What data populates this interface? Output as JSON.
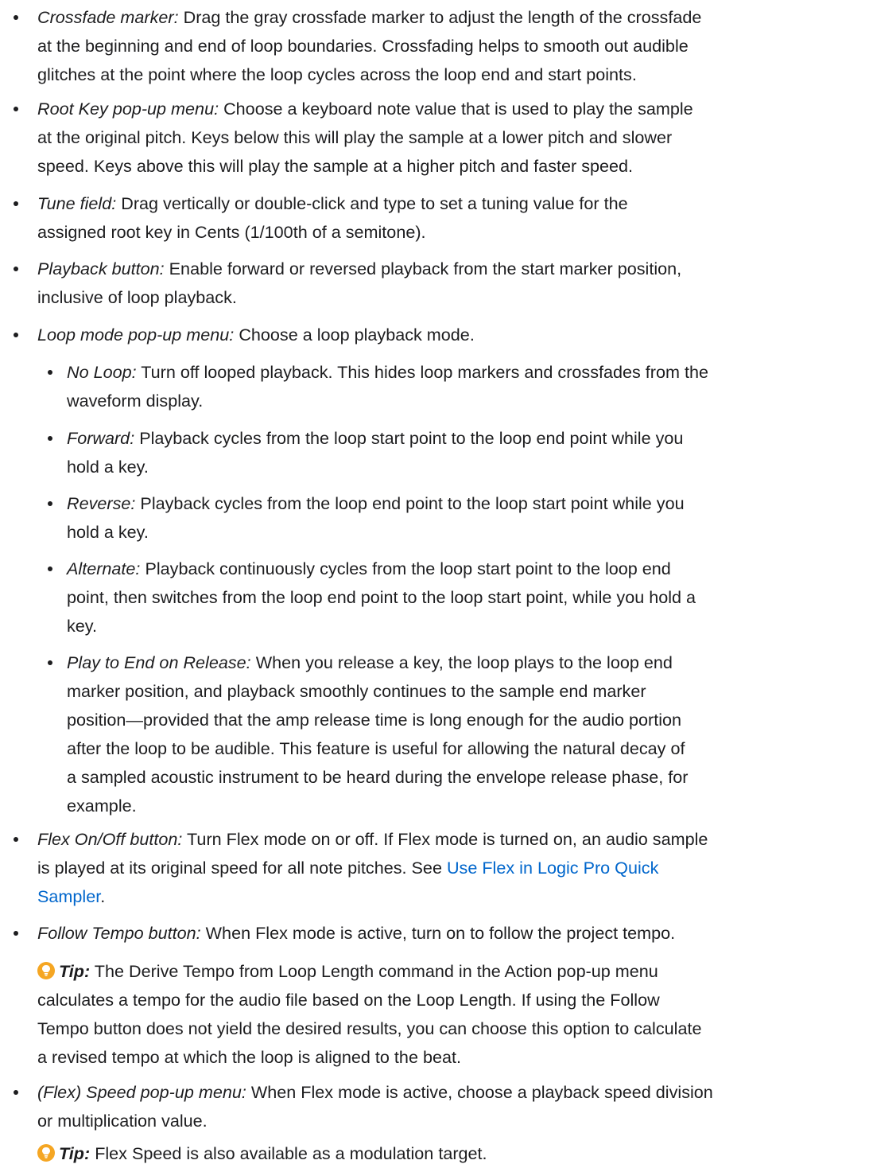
{
  "items": {
    "crossfade": {
      "term": "Crossfade marker:",
      "line1": "Drag the gray crossfade marker to adjust the length of the crossfade",
      "line2": "at the beginning and end of loop boundaries. Crossfading helps to smooth out audible",
      "line3": "glitches at the point where the loop cycles across the loop end and start points."
    },
    "root_key": {
      "term": "Root Key pop-up menu:",
      "line1": "Choose a keyboard note value that is used to play the sample",
      "line2": "at the original pitch. Keys below this will play the sample at a lower pitch and slower",
      "line3": "speed. Keys above this will play the sample at a higher pitch and faster speed."
    },
    "tune": {
      "term": "Tune field:",
      "line1": "Drag vertically or double-click and type to set a tuning value for the",
      "line2": "assigned root key in Cents (1/100th of a semitone)."
    },
    "playback": {
      "term": "Playback button:",
      "line1": "Enable forward or reversed playback from the start marker position,",
      "line2": "inclusive of loop playback."
    },
    "loop_mode": {
      "term": "Loop mode pop-up menu:",
      "line1": "Choose a loop playback mode.",
      "sub": {
        "no_loop": {
          "term": "No Loop:",
          "line1": "Turn off looped playback. This hides loop markers and crossfades from the",
          "line2": "waveform display."
        },
        "forward": {
          "term": "Forward:",
          "line1": "Playback cycles from the loop start point to the loop end point while you",
          "line2": "hold a key."
        },
        "reverse": {
          "term": "Reverse:",
          "line1": "Playback cycles from the loop end point to the loop start point while you",
          "line2": "hold a key."
        },
        "alternate": {
          "term": "Alternate:",
          "line1": "Playback continuously cycles from the loop start point to the loop end",
          "line2": "point, then switches from the loop end point to the loop start point, while you hold a",
          "line3": "key."
        },
        "play_to_end": {
          "term": "Play to End on Release:",
          "line1": "When you release a key, the loop plays to the loop end",
          "line2": "marker position, and playback smoothly continues to the sample end marker",
          "line3": "position—provided that the amp release time is long enough for the audio portion",
          "line4": "after the loop to be audible. This feature is useful for allowing the natural decay of",
          "line5": "a sampled acoustic instrument to be heard during the envelope release phase, for",
          "line6": "example."
        }
      }
    },
    "flex": {
      "term": "Flex On/Off button:",
      "line1": "Turn Flex mode on or off. If Flex mode is turned on, an audio sample",
      "line2": "is played at its original speed for all note pitches. See",
      "link_part1": "Use Flex in Logic Pro Quick",
      "link_part2": "Sampler",
      "after_link": "."
    },
    "follow_tempo": {
      "term": "Follow Tempo button:",
      "line1": "When Flex mode is active, turn on to follow the project tempo."
    },
    "tip1": {
      "label": "Tip:",
      "line1": "The Derive Tempo from Loop Length command in the Action pop-up menu",
      "line2": "calculates a tempo for the audio file based on the Loop Length. If using the Follow",
      "line3": "Tempo button does not yield the desired results, you can choose this option to calculate",
      "line4": "a revised tempo at which the loop is aligned to the beat."
    },
    "flex_speed": {
      "term": "(Flex) Speed pop-up menu:",
      "line1": "When Flex mode is active, choose a playback speed division",
      "line2": "or multiplication value."
    },
    "tip2": {
      "label": "Tip:",
      "line1": "Flex Speed is also available as a modulation target."
    }
  },
  "colors": {
    "text": "#1d1d1f",
    "link": "#0066cc",
    "tip_icon": "#f5a623"
  },
  "icons": {
    "tip": "lightbulb-icon"
  }
}
